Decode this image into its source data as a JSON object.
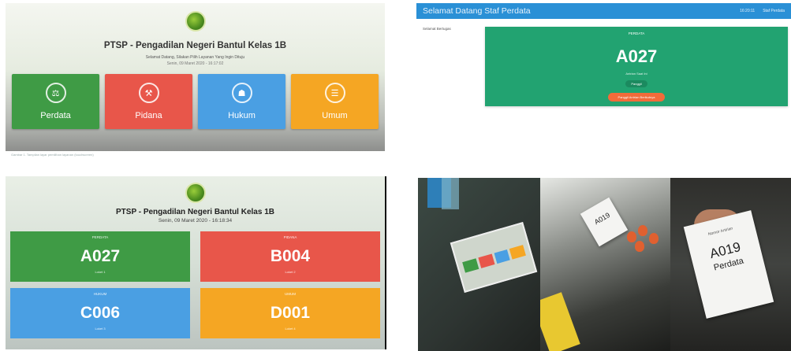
{
  "panel1": {
    "title": "PTSP - Pengadilan Negeri Bantul Kelas 1B",
    "subtitle": "Selamat Datang, Silakan Pilih Layanan Yang Ingin Dituju",
    "date": "Senin, 09 Maret 2020 - 16:17:02",
    "services": [
      {
        "label": "Perdata",
        "icon": "scales-icon",
        "color": "#3f9b45"
      },
      {
        "label": "Pidana",
        "icon": "gavel-icon",
        "color": "#e8564a"
      },
      {
        "label": "Hukum",
        "icon": "emblem-icon",
        "color": "#4a9fe3"
      },
      {
        "label": "Umum",
        "icon": "document-icon",
        "color": "#f5a623"
      }
    ],
    "caption": "Gambar 1. Tampilan layar pemilihan layanan (touchscreen)"
  },
  "panel2": {
    "app_title": "Selamat Datang Staf Perdata",
    "topbar_right": [
      "16:20:11",
      "Staf Perdata"
    ],
    "welcome_text": "Selamat Bertugas",
    "card": {
      "label": "PERDATA",
      "number": "A027",
      "status": "Antrian Saat Ini",
      "pill": "Panggil",
      "button": "Panggil Antrian Berikutnya"
    }
  },
  "panel3": {
    "title": "PTSP - Pengadilan Negeri Bantul Kelas 1B",
    "date": "Senin, 09 Maret 2020 - 16:18:34",
    "cards": [
      {
        "heading": "PERDATA",
        "number": "A027",
        "sub": "Loket 1",
        "color": "#3f9b45"
      },
      {
        "heading": "PIDANA",
        "number": "B004",
        "sub": "Loket 2",
        "color": "#e8564a"
      },
      {
        "heading": "HUKUM",
        "number": "C006",
        "sub": "Loket 3",
        "color": "#4a9fe3"
      },
      {
        "heading": "UMUM",
        "number": "D001",
        "sub": "Loket 4",
        "color": "#f5a623"
      }
    ]
  },
  "panel4": {
    "ticket_small": "A019",
    "ticket_large_header": "Nomor Antrian",
    "ticket_large_number": "A019",
    "ticket_large_category": "Perdata"
  }
}
